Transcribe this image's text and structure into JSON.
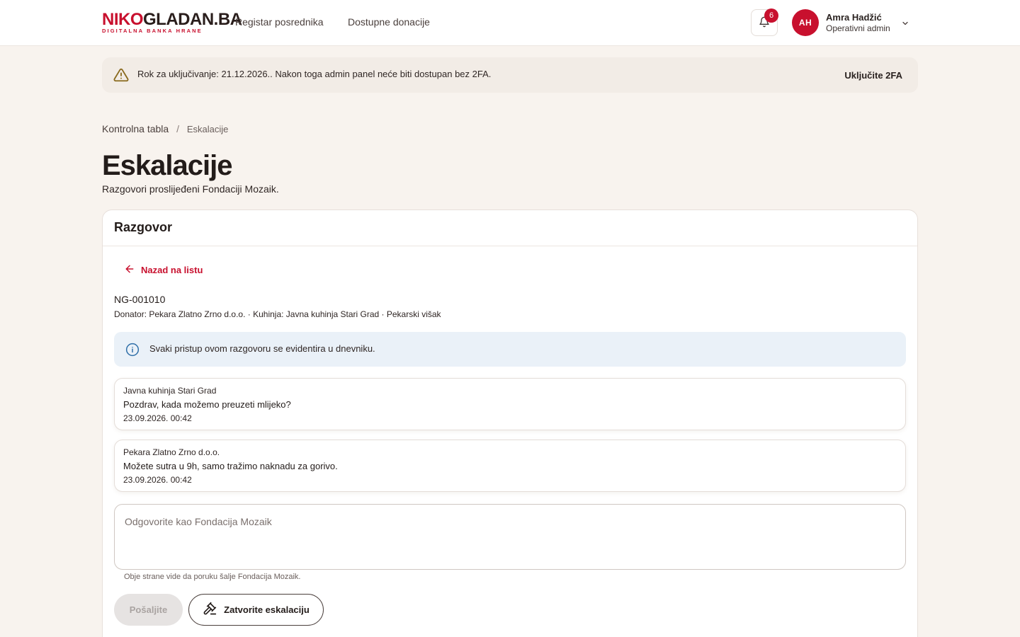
{
  "brand": {
    "logo_part1": "NIKO",
    "logo_part2": "GLADAN.BA",
    "tagline": "DIGITALNA BANKA HRANE",
    "accent": "#c8102e"
  },
  "nav": {
    "items": [
      {
        "label": "Registar posrednika"
      },
      {
        "label": "Dostupne donacije"
      }
    ]
  },
  "notifications": {
    "count": "6"
  },
  "user": {
    "initials": "AH",
    "name": "Amra Hadžić",
    "role": "Operativni admin"
  },
  "banner": {
    "text": "Rok za uključivanje: 21.12.2026.. Nakon toga admin panel neće biti dostupan bez 2FA.",
    "action": "Uključite 2FA"
  },
  "breadcrumb": {
    "root": "Kontrolna tabla",
    "separator": "/",
    "current": "Eskalacije"
  },
  "page": {
    "title": "Eskalacije",
    "subtitle": "Razgovori proslijeđeni Fondaciji Mozaik."
  },
  "conversation": {
    "card_title": "Razgovor",
    "back_label": "Nazad na listu",
    "id": "NG-001010",
    "meta": "Donator: Pekara Zlatno Zrno d.o.o. · Kuhinja: Javna kuhinja Stari Grad · Pekarski višak",
    "info": "Svaki pristup ovom razgovoru se evidentira u dnevniku.",
    "messages": [
      {
        "sender": "Javna kuhinja Stari Grad",
        "text": "Pozdrav, kada možemo preuzeti mlijeko?",
        "time": "23.09.2026. 00:42"
      },
      {
        "sender": "Pekara Zlatno Zrno d.o.o.",
        "text": "Možete sutra u 9h, samo tražimo naknadu za gorivo.",
        "time": "23.09.2026. 00:42"
      }
    ],
    "reply_placeholder": "Odgovorite kao Fondacija Mozaik",
    "reply_hint": "Obje strane vide da poruku šalje Fondacija Mozaik.",
    "send_label": "Pošaljite",
    "close_label": "Zatvorite eskalaciju"
  }
}
